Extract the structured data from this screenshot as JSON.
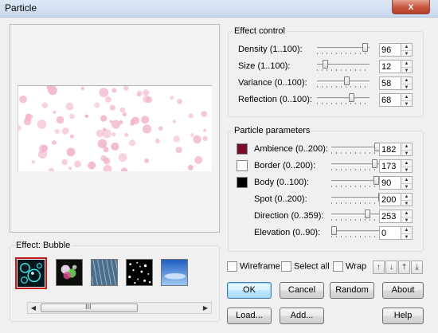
{
  "window": {
    "title": "Particle",
    "close_label": "x"
  },
  "preview": {},
  "effect": {
    "label": "Effect: Bubble",
    "thumbnails": [
      {
        "name": "bubble",
        "selected": true
      },
      {
        "name": "light-orbs",
        "selected": false
      },
      {
        "name": "rain",
        "selected": false
      },
      {
        "name": "snow",
        "selected": false
      },
      {
        "name": "sky",
        "selected": false
      }
    ],
    "scrollbar_grip": "III"
  },
  "effect_control": {
    "title": "Effect control",
    "rows": [
      {
        "label": "Density (1..100):",
        "value": "96",
        "fraction": 0.96
      },
      {
        "label": "Size (1..100):",
        "value": "12",
        "fraction": 0.12
      },
      {
        "label": "Variance (0..100):",
        "value": "58",
        "fraction": 0.58
      },
      {
        "label": "Reflection (0..100):",
        "value": "68",
        "fraction": 0.68
      }
    ]
  },
  "particle_params": {
    "title": "Particle parameters",
    "rows": [
      {
        "label": "Ambience (0..200):",
        "value": "182",
        "fraction": 0.91,
        "swatch": "#7a0a2a"
      },
      {
        "label": "Border (0..200):",
        "value": "173",
        "fraction": 0.865,
        "swatch": "#ffffff"
      },
      {
        "label": "Body (0..100):",
        "value": "90",
        "fraction": 0.9,
        "swatch": "#000000"
      },
      {
        "label": "Spot (0..200):",
        "value": "200",
        "fraction": 1.0
      },
      {
        "label": "Direction (0..359):",
        "value": "253",
        "fraction": 0.705
      },
      {
        "label": "Elevation (0..90):",
        "value": "0",
        "fraction": 0.0
      }
    ]
  },
  "options": {
    "wireframe": "Wireframe",
    "select_all": "Select all",
    "wrap": "Wrap",
    "arrows": [
      "↑",
      "↓",
      "⤒",
      "⤓"
    ]
  },
  "buttons": {
    "ok": "OK",
    "cancel": "Cancel",
    "random": "Random",
    "about": "About",
    "load": "Load...",
    "add": "Add...",
    "help": "Help"
  },
  "colors": {
    "selection": "#c01818",
    "bubble": "#f2b6cf"
  }
}
